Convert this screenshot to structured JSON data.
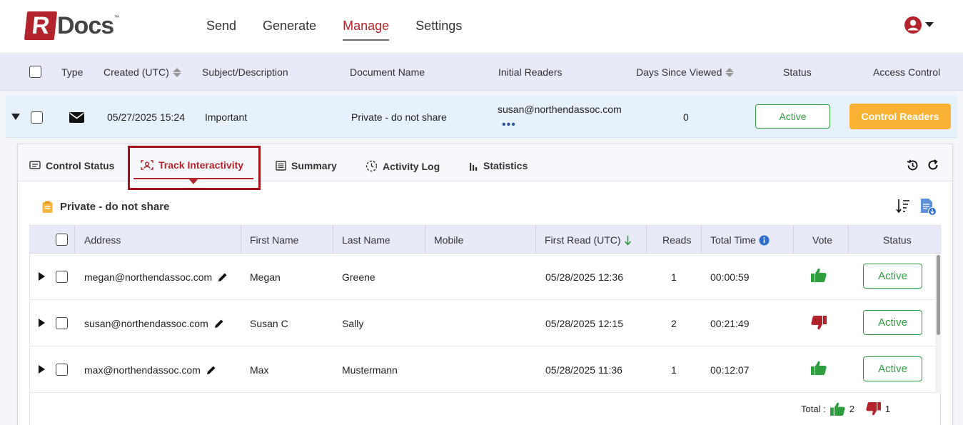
{
  "app": {
    "logo_letter": "R",
    "logo_text": "Docs",
    "logo_tm": "™"
  },
  "nav": {
    "items": [
      "Send",
      "Generate",
      "Manage",
      "Settings"
    ],
    "active": "Manage"
  },
  "main_table": {
    "headers": {
      "type": "Type",
      "created": "Created (UTC)",
      "subject": "Subject/Description",
      "document": "Document Name",
      "readers": "Initial Readers",
      "days": "Days Since Viewed",
      "status": "Status",
      "access": "Access Control"
    },
    "row": {
      "created": "05/27/2025 15:24",
      "subject": "Important",
      "document": "Private - do not share",
      "readers": "susan@northendassoc.com",
      "readers_more": "•••",
      "days": "0",
      "status": "Active",
      "action": "Control Readers"
    }
  },
  "tabs": [
    "Control Status",
    "Track Interactivity",
    "Summary",
    "Activity Log",
    "Statistics"
  ],
  "active_tab": "Track Interactivity",
  "document_title": "Private - do not share",
  "inner_table": {
    "headers": {
      "address": "Address",
      "first": "First Name",
      "last": "Last Name",
      "mobile": "Mobile",
      "first_read": "First Read (UTC)",
      "reads": "Reads",
      "total_time": "Total Time",
      "vote": "Vote",
      "status": "Status"
    },
    "rows": [
      {
        "address": "megan@northendassoc.com",
        "first": "Megan",
        "last": "Greene",
        "mobile": "",
        "first_read": "05/28/2025 12:36",
        "reads": "1",
        "total_time": "00:00:59",
        "vote": "up",
        "status": "Active"
      },
      {
        "address": "susan@northendassoc.com",
        "first": "Susan C",
        "last": "Sally",
        "mobile": "",
        "first_read": "05/28/2025 12:15",
        "reads": "2",
        "total_time": "00:21:49",
        "vote": "down",
        "status": "Active"
      },
      {
        "address": "max@northendassoc.com",
        "first": "Max",
        "last": "Mustermann",
        "mobile": "",
        "first_read": "05/28/2025 11:36",
        "reads": "1",
        "total_time": "00:12:07",
        "vote": "up",
        "status": "Active"
      }
    ],
    "totals": {
      "label": "Total :",
      "up": "2",
      "down": "1"
    }
  },
  "colors": {
    "brand": "#b3232b",
    "active_green": "#2e9e3e",
    "control_orange": "#f9b233",
    "vote_up": "#2e9e3e",
    "vote_down": "#b3232b"
  },
  "icons": {
    "type": "envelope-icon",
    "user": "user-circle-icon",
    "history": "history-icon",
    "refresh": "refresh-icon",
    "doc": "clipboard-icon",
    "sort": "sort-list-icon",
    "export": "file-export-icon",
    "edit": "pencil-icon",
    "info": "info-icon"
  }
}
